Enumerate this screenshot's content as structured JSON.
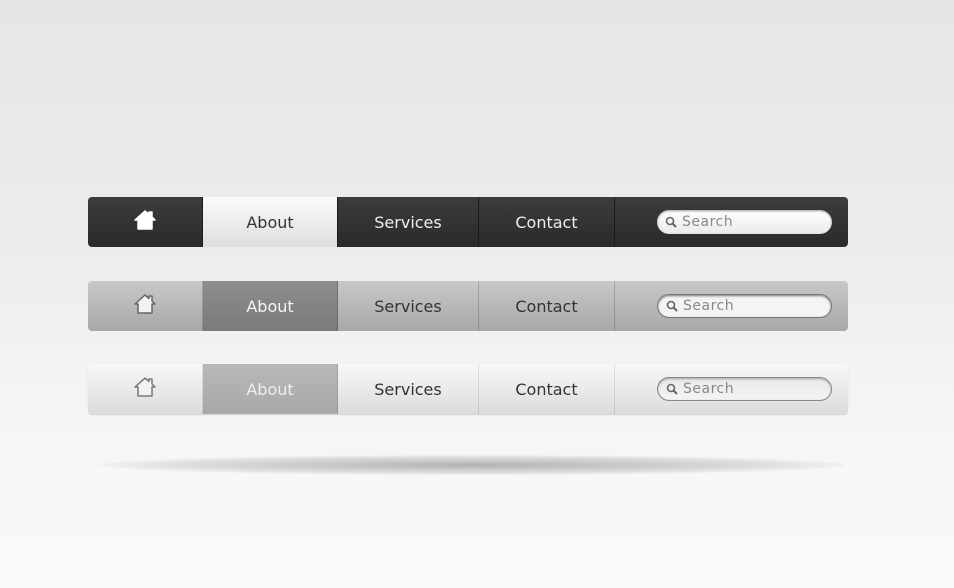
{
  "navbars": [
    {
      "variant": "dark",
      "home_icon": "home-icon",
      "items": [
        "About",
        "Services",
        "Contact"
      ],
      "active": "About",
      "search": {
        "placeholder": "Search",
        "icon": "search-icon"
      }
    },
    {
      "variant": "medium",
      "home_icon": "home-icon",
      "items": [
        "About",
        "Services",
        "Contact"
      ],
      "active": "About",
      "search": {
        "placeholder": "Search",
        "icon": "search-icon"
      }
    },
    {
      "variant": "light",
      "home_icon": "home-icon",
      "items": [
        "About",
        "Services",
        "Contact"
      ],
      "active": "About",
      "search": {
        "placeholder": "Search",
        "icon": "search-icon"
      }
    }
  ]
}
